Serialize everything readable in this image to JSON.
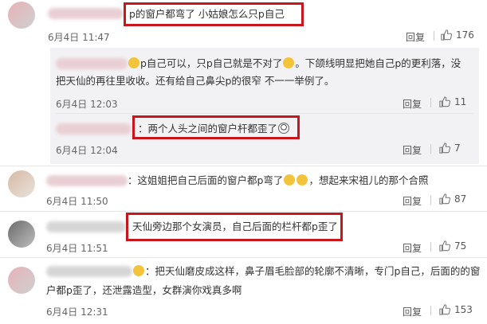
{
  "comments": [
    {
      "text": "p的窗户都弯了 小姑娘怎么只p自己",
      "date": "6月4日 11:47",
      "reply": "回复",
      "likes": "176"
    },
    {
      "text": "p自己可以，只p自己就是不对了",
      "text_cont": "。下颌线明显把她自己p的更利落，没",
      "line2": "把天仙的再往里收收。还有给自己鼻尖p的很窄 不一一举例了。",
      "date": "6月4日 12:03",
      "reply": "回复",
      "likes": "11"
    },
    {
      "text": "两个人头之间的窗户杆都歪了",
      "date": "6月4日 12:04",
      "reply": "回复",
      "likes": "7"
    },
    {
      "text": "：这姐姐把自己后面的窗户都p弯了",
      "text_cont": "，想起来宋祖儿的那个合照",
      "date": "6月4日 11:50",
      "reply": "回复",
      "likes": "87"
    },
    {
      "text": "天仙旁边那个女演员，自己后面的栏杆都p歪了",
      "date": "6月4日 11:51",
      "reply": "回复",
      "likes": "75"
    },
    {
      "text": "：把天仙磨皮成这样，鼻子眉毛脸部的轮廓不清晰，专门p自己，后面的的窗",
      "line2": "户都p歪了，还泄露造型，女群演你戏真多啊",
      "date": "6月4日 12:31",
      "reply": "回复",
      "likes": "153"
    }
  ],
  "colors": {
    "highlight": "#c8161d",
    "panel": "#f2f2f5",
    "text": "#333333",
    "meta": "#666666"
  },
  "icons": {
    "like": "thumbs-up-icon",
    "emoji": "grin-emoji-icon"
  }
}
